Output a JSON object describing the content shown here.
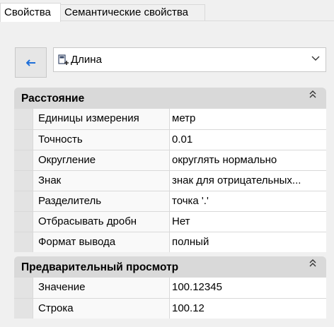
{
  "tabs": [
    {
      "label": "Свойства",
      "active": true
    },
    {
      "label": "Семантические свойства",
      "active": false
    }
  ],
  "toolbar": {
    "back_icon": "arrow-left-icon",
    "selected_value": "Длина",
    "selected_icon": "length-measure-icon",
    "dropdown_icon": "chevron-down-icon"
  },
  "sections": [
    {
      "title": "Расстояние",
      "collapse_icon": "double-chevron-up-icon",
      "rows": [
        {
          "name": "Единицы измерения",
          "value": "метр"
        },
        {
          "name": "Точность",
          "value": "0.01"
        },
        {
          "name": "Округление",
          "value": "округлять нормально"
        },
        {
          "name": "Знак",
          "value": "знак для отрицательных..."
        },
        {
          "name": "Разделитель",
          "value": "точка '.'"
        },
        {
          "name": "Отбрасывать дробн",
          "value": "Нет"
        },
        {
          "name": "Формат вывода",
          "value": "полный"
        }
      ]
    },
    {
      "title": "Предварительный просмотр",
      "collapse_icon": "double-chevron-up-icon",
      "rows": [
        {
          "name": "Значение",
          "value": "100.12345"
        },
        {
          "name": "Строка",
          "value": "100.12"
        }
      ]
    }
  ],
  "colors": {
    "accent": "#1e6fd9",
    "section_header": "#d9d9d9",
    "background": "#f0f0f0"
  }
}
